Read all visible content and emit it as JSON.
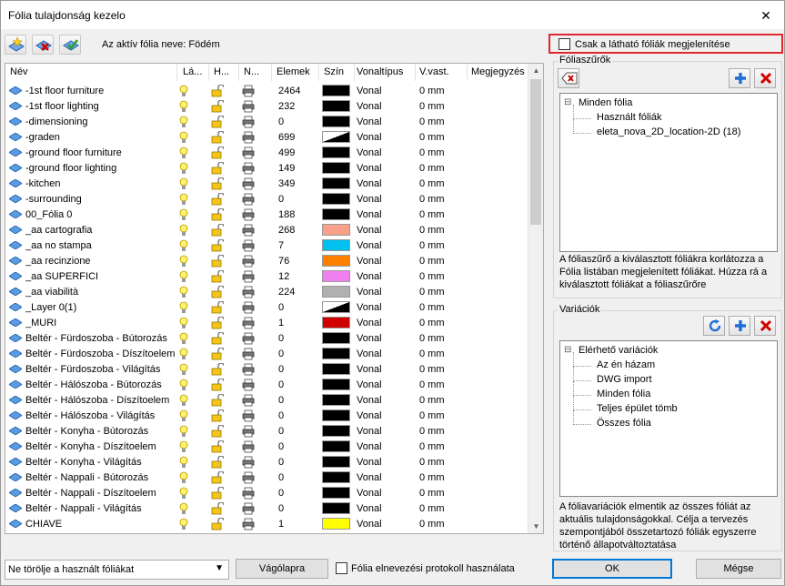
{
  "window": {
    "title": "Fólia tulajdonság kezelo",
    "close_glyph": "✕"
  },
  "toolbar": {
    "active_layer_text": "Az aktív fólia neve: Födém",
    "icons": [
      "new-layer-icon",
      "delete-layer-icon",
      "accept-layer-icon"
    ]
  },
  "visible_only": {
    "label": "Csak a látható fóliák megjelenítése",
    "checked": false
  },
  "table": {
    "columns": [
      "Név",
      "Lá...",
      "H...",
      "N...",
      "Elemek",
      "Szín",
      "Vonaltípus",
      "V.vast.",
      "Megjegyzés"
    ],
    "rows": [
      {
        "name": "-1st floor furniture",
        "elements": "2464",
        "color": "#000000",
        "linetype": "Vonal",
        "width": "0 mm"
      },
      {
        "name": "-1st floor lighting",
        "elements": "232",
        "color": "#000000",
        "linetype": "Vonal",
        "width": "0 mm"
      },
      {
        "name": "-dimensioning",
        "elements": "0",
        "color": "#000000",
        "linetype": "Vonal",
        "width": "0 mm"
      },
      {
        "name": "-graden",
        "elements": "699",
        "color": "half-black-white",
        "linetype": "Vonal",
        "width": "0 mm"
      },
      {
        "name": "-ground floor furniture",
        "elements": "499",
        "color": "#000000",
        "linetype": "Vonal",
        "width": "0 mm"
      },
      {
        "name": "-ground floor lighting",
        "elements": "149",
        "color": "#000000",
        "linetype": "Vonal",
        "width": "0 mm"
      },
      {
        "name": "-kitchen",
        "elements": "349",
        "color": "#000000",
        "linetype": "Vonal",
        "width": "0 mm"
      },
      {
        "name": "-surrounding",
        "elements": "0",
        "color": "#000000",
        "linetype": "Vonal",
        "width": "0 mm"
      },
      {
        "name": "00_Fólia 0",
        "elements": "188",
        "color": "#000000",
        "linetype": "Vonal",
        "width": "0 mm"
      },
      {
        "name": "_aa cartografia",
        "elements": "268",
        "color": "#f9a08a",
        "linetype": "Vonal",
        "width": "0 mm"
      },
      {
        "name": "_aa no stampa",
        "elements": "7",
        "color": "#00c0f0",
        "linetype": "Vonal",
        "width": "0 mm"
      },
      {
        "name": "_aa recinzione",
        "elements": "76",
        "color": "#ff8000",
        "linetype": "Vonal",
        "width": "0 mm"
      },
      {
        "name": "_aa SUPERFICI",
        "elements": "12",
        "color": "#f080f0",
        "linetype": "Vonal",
        "width": "0 mm"
      },
      {
        "name": "_aa viabilità",
        "elements": "224",
        "color": "#b0b0b0",
        "linetype": "Vonal",
        "width": "0 mm"
      },
      {
        "name": "_Layer 0(1)",
        "elements": "0",
        "color": "half-black-white",
        "linetype": "Vonal",
        "width": "0 mm"
      },
      {
        "name": "_MURI",
        "elements": "1",
        "color": "#d00000",
        "linetype": "Vonal",
        "width": "0 mm"
      },
      {
        "name": "Beltér - Fürdoszoba - Bútorozás",
        "elements": "0",
        "color": "#000000",
        "linetype": "Vonal",
        "width": "0 mm"
      },
      {
        "name": "Beltér - Fürdoszoba - Díszítoelem",
        "elements": "0",
        "color": "#000000",
        "linetype": "Vonal",
        "width": "0 mm"
      },
      {
        "name": "Beltér - Fürdoszoba - Világítás",
        "elements": "0",
        "color": "#000000",
        "linetype": "Vonal",
        "width": "0 mm"
      },
      {
        "name": "Beltér - Hálószoba - Bútorozás",
        "elements": "0",
        "color": "#000000",
        "linetype": "Vonal",
        "width": "0 mm"
      },
      {
        "name": "Beltér - Hálószoba - Díszítoelem",
        "elements": "0",
        "color": "#000000",
        "linetype": "Vonal",
        "width": "0 mm"
      },
      {
        "name": "Beltér - Hálószoba - Világítás",
        "elements": "0",
        "color": "#000000",
        "linetype": "Vonal",
        "width": "0 mm"
      },
      {
        "name": "Beltér - Konyha - Bútorozás",
        "elements": "0",
        "color": "#000000",
        "linetype": "Vonal",
        "width": "0 mm"
      },
      {
        "name": "Beltér - Konyha - Díszítoelem",
        "elements": "0",
        "color": "#000000",
        "linetype": "Vonal",
        "width": "0 mm"
      },
      {
        "name": "Beltér - Konyha - Világítás",
        "elements": "0",
        "color": "#000000",
        "linetype": "Vonal",
        "width": "0 mm"
      },
      {
        "name": "Beltér - Nappali - Bútorozás",
        "elements": "0",
        "color": "#000000",
        "linetype": "Vonal",
        "width": "0 mm"
      },
      {
        "name": "Beltér - Nappali - Díszítoelem",
        "elements": "0",
        "color": "#000000",
        "linetype": "Vonal",
        "width": "0 mm"
      },
      {
        "name": "Beltér - Nappali - Világítás",
        "elements": "0",
        "color": "#000000",
        "linetype": "Vonal",
        "width": "0 mm"
      },
      {
        "name": "CHIAVE",
        "elements": "1",
        "color": "#ffff00",
        "linetype": "Vonal",
        "width": "0 mm"
      }
    ]
  },
  "filters": {
    "title": "Fóliaszűrők",
    "tree": [
      {
        "label": "Minden fólia",
        "level": 0,
        "expander": "⊟"
      },
      {
        "label": "Használt fóliák",
        "level": 1
      },
      {
        "label": "eleta_nova_2D_location-2D (18)",
        "level": 1
      }
    ],
    "description": "A fóliaszűrő a kiválasztott fóliákra korlátozza a Fólia listában megjelenített fóliákat. Húzza rá a kiválasztott fóliákat a fóliaszűrőre"
  },
  "variations": {
    "title": "Variációk",
    "tree": [
      {
        "label": "Elérhető variációk",
        "level": 0,
        "expander": "⊟"
      },
      {
        "label": "Az én házam",
        "level": 1
      },
      {
        "label": "DWG import",
        "level": 1
      },
      {
        "label": "Minden fólia",
        "level": 1
      },
      {
        "label": "Teljes épület tömb",
        "level": 1
      },
      {
        "label": "Összes fólia",
        "level": 1
      }
    ],
    "description": "A fóliavariációk elmentik az összes fóliát az aktuális tulajdonságokkal. Célja a tervezés szempontjából összetartozó fóliák egyszerre történő állapotváltoztatása"
  },
  "bottom": {
    "delete_combo_value": "Ne törölje a használt fóliákat",
    "clipboard_label": "Vágólapra",
    "protocol_label": "Fólia elnevezési protokoll használata",
    "ok_label": "OK",
    "cancel_label": "Mégse"
  }
}
